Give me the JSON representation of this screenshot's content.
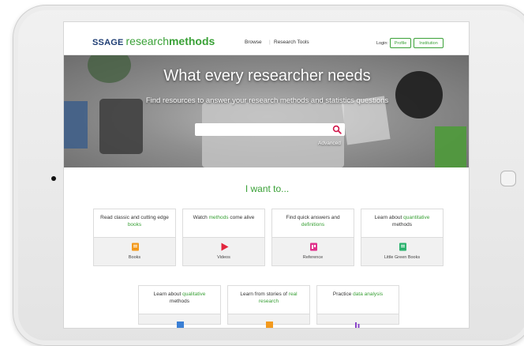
{
  "header": {
    "logo_brand": "SSAGE",
    "logo_word1": "research",
    "logo_word2": "methods",
    "nav_browse": "Browse",
    "nav_sep": "|",
    "nav_tools": "Research Tools",
    "login_label": "Login:",
    "profile_button": "Profile",
    "institution_button": "Institution"
  },
  "hero": {
    "title": "What every researcher needs",
    "subtitle": "Find resources to answer your research methods and statistics questions",
    "search_placeholder": "",
    "advanced_link": "Advanced"
  },
  "section_title": "I want to...",
  "cards_row1": [
    {
      "pre": "Read classic and cutting edge ",
      "hl": "books",
      "post": "",
      "label": "Books",
      "icon_color": "#f39a1e",
      "icon": "book-icon"
    },
    {
      "pre": "Watch ",
      "hl": "methods",
      "post": " come alive",
      "label": "Videos",
      "icon_color": "#e2263d",
      "icon": "play-icon"
    },
    {
      "pre": "Find quick answers and ",
      "hl": "definitions",
      "post": "",
      "label": "Reference",
      "icon_color": "#e0308a",
      "icon": "reference-icon"
    },
    {
      "pre": "Learn about ",
      "hl": "quantitative",
      "post": " methods",
      "label": "Little Green Books",
      "icon_color": "#2db36f",
      "icon": "green-book-icon"
    }
  ],
  "cards_row2": [
    {
      "pre": "Learn about ",
      "hl": "qualitative",
      "post": " methods",
      "icon_color": "#3a7fd5",
      "icon": "doc-icon"
    },
    {
      "pre": "Learn from stories of ",
      "hl": "real research",
      "post": "",
      "icon_color": "#f39a1e",
      "icon": "case-icon"
    },
    {
      "pre": "Practice ",
      "hl": "data analysis",
      "post": "",
      "icon_color": "#8a44c8",
      "icon": "chart-icon"
    }
  ],
  "colors": {
    "brand_green": "#3aa137",
    "sage_blue": "#1f3e74",
    "search_icon": "#d1174a"
  }
}
